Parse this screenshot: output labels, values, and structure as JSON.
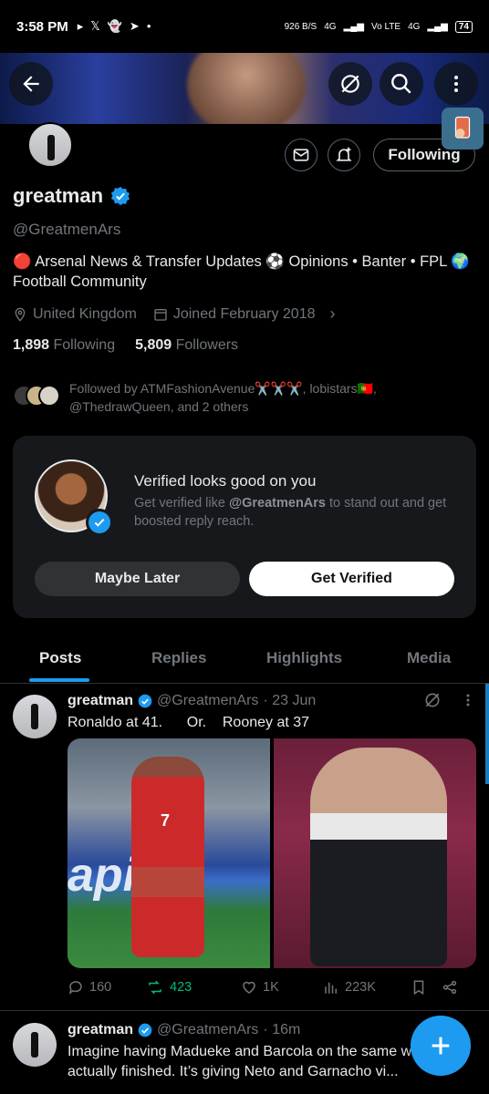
{
  "status_bar": {
    "time": "3:58 PM",
    "net_speed": "926 B/S",
    "net1": "4G",
    "net2": "Vo LTE",
    "net3": "4G",
    "battery": "74"
  },
  "profile": {
    "display_name": "greatman",
    "handle": "@GreatmenArs",
    "bio_line1": "🔴 Arsenal News & Transfer Updates ⚽ Opinions • Banter • FPL 🌍",
    "bio_line2": "Football Community",
    "location": "United Kingdom",
    "joined": "Joined February 2018",
    "following_count": "1,898",
    "following_label": "Following",
    "followers_count": "5,809",
    "followers_label": "Followers",
    "followed_by": "Followed by ATMFashionAvenue✂️✂️✂️, lobistars🇵🇹, @ThedrawQueen, and 2 others",
    "follow_button": "Following"
  },
  "verify_card": {
    "title": "Verified looks good on you",
    "subtitle_pre": "Get verified like ",
    "subtitle_handle": "@GreatmenArs",
    "subtitle_post": " to stand out and get boosted reply reach.",
    "maybe_later": "Maybe Later",
    "get_verified": "Get Verified"
  },
  "tabs": [
    "Posts",
    "Replies",
    "Highlights",
    "Media"
  ],
  "tweets": [
    {
      "name": "greatman",
      "handle": "@GreatmenArs",
      "time": "· 23 Jun",
      "text": "Ronaldo at 41.      Or.    Rooney at 37",
      "media_text": "apin",
      "jersey_number": "7",
      "replies": "160",
      "retweets": "423",
      "likes": "1K",
      "views": "223K"
    },
    {
      "name": "greatman",
      "handle": "@GreatmenArs",
      "time": "· 16m",
      "text": "Imagine having Madueke and Barcola on the same wi... We’re actually finished. It’s giving Neto and Garnacho vi..."
    }
  ],
  "colors": {
    "accent": "#1d9bf0",
    "retweet_green": "#00ba7c",
    "background": "#000000",
    "muted": "#71767b"
  }
}
